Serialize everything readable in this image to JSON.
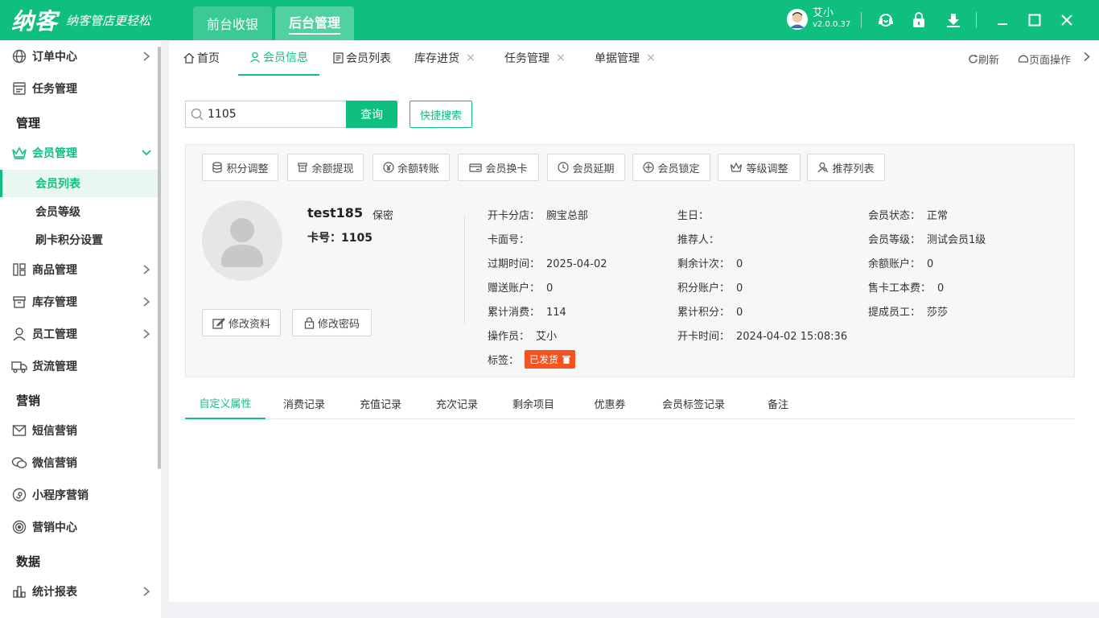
{
  "app": {
    "logo": "纳客",
    "slogan": "纳客管店更轻松",
    "top_tabs": [
      "前台收银",
      "后台管理"
    ],
    "user_name": "艾小",
    "version": "v2.0.0.37"
  },
  "colors": {
    "accent": "#0fbf7e",
    "tag": "#f5531f"
  },
  "sidebar": {
    "items": {
      "order": "订单中心",
      "task": "任务管理",
      "section_manage": "管理",
      "member": "会员管理",
      "member_list": "会员列表",
      "member_level": "会员等级",
      "card_points": "刷卡积分设置",
      "goods": "商品管理",
      "stock": "库存管理",
      "staff": "员工管理",
      "logistics": "货流管理",
      "section_marketing": "营销",
      "sms": "短信营销",
      "wechat": "微信营销",
      "miniapp": "小程序营销",
      "marketing_center": "营销中心",
      "section_data": "数据",
      "report": "统计报表"
    }
  },
  "page_tabs": [
    "首页",
    "会员信息",
    "会员列表",
    "库存进货",
    "任务管理",
    "单据管理"
  ],
  "tab_tools": {
    "refresh": "刷新",
    "page_ops": "页面操作"
  },
  "search": {
    "value": "1105",
    "button": "查询",
    "quick": "快捷搜索"
  },
  "actions": [
    "积分调整",
    "余额提现",
    "余额转账",
    "会员换卡",
    "会员延期",
    "会员锁定",
    "等级调整",
    "推荐列表"
  ],
  "member": {
    "name": "test185",
    "gender": "保密",
    "card_line": "卡号：1105",
    "edit_profile": "修改资料",
    "edit_password": "修改密码",
    "fields": {
      "branch_l": "开卡分店：",
      "branch_v": "腕宝总部",
      "cardface_l": "卡面号：",
      "cardface_v": "",
      "expire_l": "过期时间：",
      "expire_v": "2025-04-02",
      "gift_l": "赠送账户：",
      "gift_v": "0",
      "total_spend_l": "累计消费：",
      "total_spend_v": "114",
      "operator_l": "操作员：",
      "operator_v": "艾小",
      "tag_l": "标签：",
      "birthday_l": "生日：",
      "birthday_v": "",
      "referrer_l": "推荐人：",
      "referrer_v": "",
      "remain_count_l": "剩余计次：",
      "remain_count_v": "0",
      "points_acc_l": "积分账户：",
      "points_acc_v": "0",
      "total_points_l": "累计积分：",
      "total_points_v": "0",
      "open_time_l": "开卡时间：",
      "open_time_v": "2024-04-02 15:08:36",
      "status_l": "会员状态：",
      "status_v": "正常",
      "level_l": "会员等级：",
      "level_v": "测试会员1级",
      "balance_l": "余额账户：",
      "balance_v": "0",
      "card_fee_l": "售卡工本费：",
      "card_fee_v": "0",
      "commission_l": "提成员工：",
      "commission_v": "莎莎"
    },
    "tag": "已发货"
  },
  "sub_tabs": [
    "自定义属性",
    "消费记录",
    "充值记录",
    "充次记录",
    "剩余项目",
    "优惠券",
    "会员标签记录",
    "备注"
  ]
}
